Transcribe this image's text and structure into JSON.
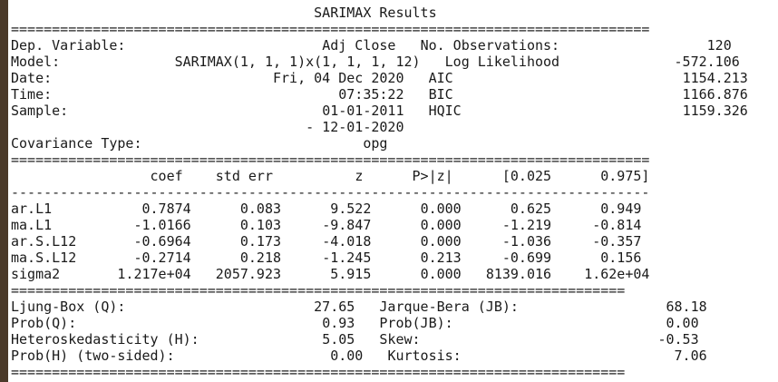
{
  "title": "SARIMAX Results",
  "sep_eq": "==============================================================================",
  "sep_dash": "------------------------------------------------------------------------------",
  "sep_eq_short": "===========================================================================",
  "header": {
    "dep_label": "Dep. Variable:",
    "dep_value": "Adj Close",
    "nobs_label": "No. Observations:",
    "nobs_value": "120",
    "model_label": "Model:",
    "model_value": "SARIMAX(1, 1, 1)x(1, 1, 1, 12)",
    "ll_label": "Log Likelihood",
    "ll_value": "-572.106",
    "date_label": "Date:",
    "date_value": "Fri, 04 Dec 2020",
    "aic_label": "AIC",
    "aic_value": "1154.213",
    "time_label": "Time:",
    "time_value": "07:35:22",
    "bic_label": "BIC",
    "bic_value": "1166.876",
    "sample_label": "Sample:",
    "sample_value": "01-01-2011",
    "hqic_label": "HQIC",
    "hqic_value": "1159.326",
    "sample_end": "- 12-01-2020",
    "cov_label": "Covariance Type:",
    "cov_value": "opg"
  },
  "coef_headers": [
    "coef",
    "std err",
    "z",
    "P>|z|",
    "[0.025",
    "0.975]"
  ],
  "coef_rows": [
    [
      "ar.L1",
      "0.7874",
      "0.083",
      "9.522",
      "0.000",
      "0.625",
      "0.949"
    ],
    [
      "ma.L1",
      "-1.0166",
      "0.103",
      "-9.847",
      "0.000",
      "-1.219",
      "-0.814"
    ],
    [
      "ar.S.L12",
      "-0.6964",
      "0.173",
      "-4.018",
      "0.000",
      "-1.036",
      "-0.357"
    ],
    [
      "ma.S.L12",
      "-0.2714",
      "0.218",
      "-1.245",
      "0.213",
      "-0.699",
      "0.156"
    ],
    [
      "sigma2",
      "1.217e+04",
      "2057.923",
      "5.915",
      "0.000",
      "8139.016",
      "1.62e+04"
    ]
  ],
  "diag_rows": [
    [
      "Ljung-Box (Q):",
      "27.65",
      "Jarque-Bera (JB):",
      "68.18"
    ],
    [
      "Prob(Q):",
      "0.93",
      "Prob(JB):",
      "0.00"
    ],
    [
      "Heteroskedasticity (H):",
      "5.05",
      "Skew:",
      "-0.53"
    ],
    [
      "Prob(H) (two-sided):",
      "0.00",
      "Kurtosis:",
      "7.06"
    ]
  ]
}
